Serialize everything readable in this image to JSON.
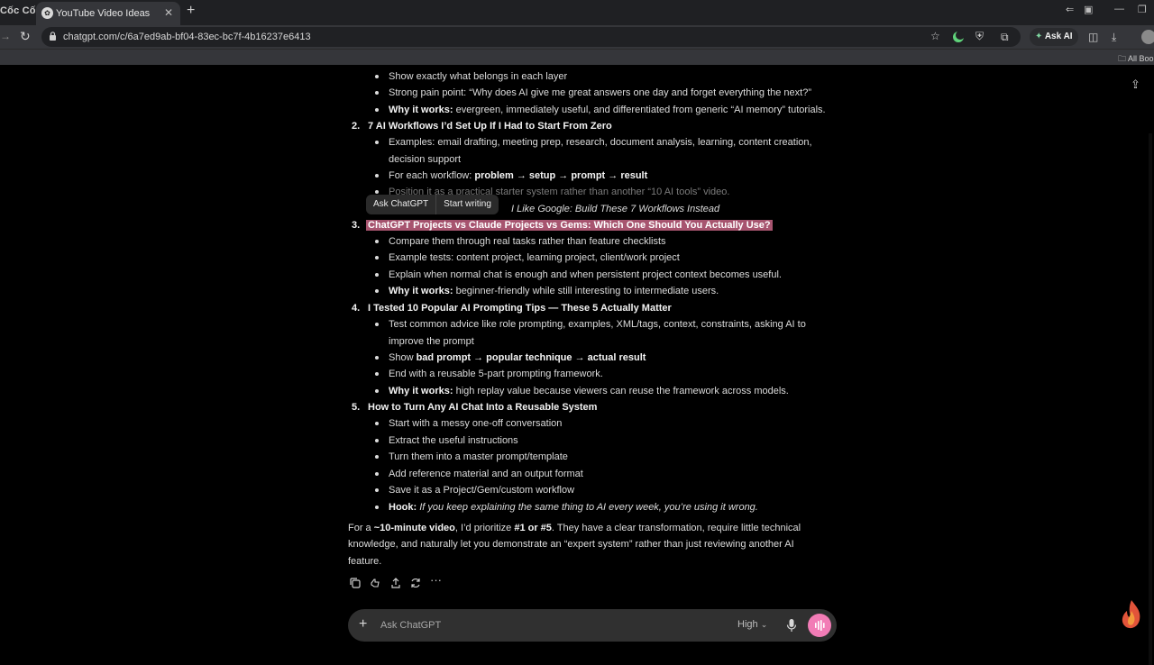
{
  "browser": {
    "brand": "Cốc Cốc",
    "tab_title": "YouTube Video Ideas",
    "url": "chatgpt.com/c/6a7ed9ab-bf04-83ec-bc7f-4b16237e6413",
    "ask_ai_label": "Ask AI",
    "all_bookmarks": "All Boo"
  },
  "selection_popup": {
    "ask_label": "Ask ChatGPT",
    "write_label": "Start writing"
  },
  "content": {
    "top_bullets": [
      {
        "t": "Show exactly what belongs in each layer"
      },
      {
        "t": "Strong pain point: “Why does AI give me great answers one day and forget everything the next?”"
      },
      {
        "b": "Why it works:",
        "t": " evergreen, immediately useful, and differentiated from generic “AI memory” tutorials."
      }
    ],
    "item2": {
      "num": "2.",
      "title": "7 AI Workflows I’d Set Up If I Had to Start From Zero",
      "bullets": {
        "b1_line1": "Examples: email drafting, meeting prep, research, document analysis, learning, content creation,",
        "b1_line2": "decision support",
        "b2_pre": "For each workflow: ",
        "b2_bold": "problem → setup → prompt → result",
        "b3": "Position it as a practical starter system rather than another “10 AI tools” video.",
        "b4_italic": "I Like Google: Build These 7 Workflows Instead"
      }
    },
    "item3": {
      "num": "3.",
      "title": "ChatGPT Projects vs Claude Projects vs Gems: Which One Should You Actually Use?",
      "bullets": [
        {
          "t": "Compare them through real tasks rather than feature checklists"
        },
        {
          "t": "Example tests: content project, learning project, client/work project"
        },
        {
          "t": "Explain when normal chat is enough and when persistent project context becomes useful."
        },
        {
          "b": "Why it works:",
          "t": " beginner-friendly while still interesting to intermediate users."
        }
      ]
    },
    "item4": {
      "num": "4.",
      "title": "I Tested 10 Popular AI Prompting Tips — These 5 Actually Matter",
      "bullets": {
        "b1_line1": "Test common advice like role prompting, examples, XML/tags, context, constraints, asking AI to",
        "b1_line2": "improve the prompt",
        "b2_pre": "Show ",
        "b2_bold": "bad prompt → popular technique → actual result",
        "b3": "End with a reusable 5-part prompting framework.",
        "b4_bold": "Why it works:",
        "b4_text": " high replay value because viewers can reuse the framework across models."
      }
    },
    "item5": {
      "num": "5.",
      "title": "How to Turn Any AI Chat Into a Reusable System",
      "bullets": {
        "b1": "Start with a messy one-off conversation",
        "b2": "Extract the useful instructions",
        "b3": "Turn them into a master prompt/template",
        "b4": "Add reference material and an output format",
        "b5": "Save it as a Project/Gem/custom workflow",
        "b6_bold": "Hook:",
        "b6_italic": " If you keep explaining the same thing to AI every week, you’re using it wrong."
      }
    },
    "summary": {
      "p1": "For a ",
      "b1": "~10-minute video",
      "p2": ", I’d prioritize ",
      "b2": "#1 or #5",
      "p3": ". They have a clear transformation, require little technical knowledge, and naturally let you demonstrate an “expert system” rather than just reviewing another AI feature."
    }
  },
  "composer": {
    "placeholder": "Ask ChatGPT",
    "model": "High"
  }
}
